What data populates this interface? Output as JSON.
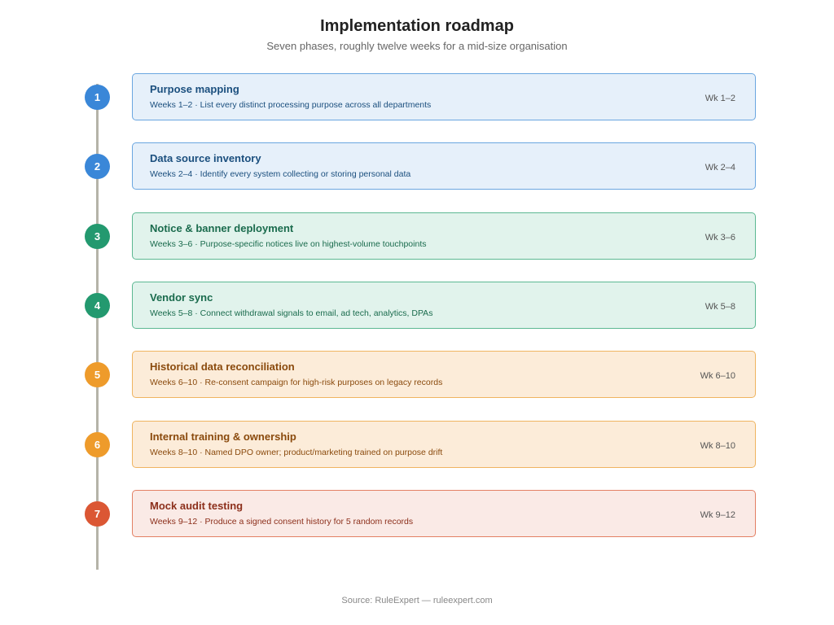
{
  "header": {
    "title": "Implementation roadmap",
    "subtitle": "Seven phases, roughly twelve weeks for a mid-size organisation"
  },
  "themes": {
    "blue": {
      "node": "#3a87d8",
      "bg": "#e6f0fa",
      "border": "#6aa6e0",
      "text": "#1b4f7e"
    },
    "green": {
      "node": "#23996f",
      "bg": "#e1f3ec",
      "border": "#5cb892",
      "text": "#1a6b4d"
    },
    "amber": {
      "node": "#ee9b2b",
      "bg": "#fcecd9",
      "border": "#efb460",
      "text": "#8a4a0d"
    },
    "red": {
      "node": "#db5734",
      "bg": "#faeae6",
      "border": "#e38064",
      "text": "#8c2f1b"
    }
  },
  "phases": [
    {
      "number": "1",
      "title": "Purpose mapping",
      "description": "Weeks 1–2 · List every distinct processing purpose across all departments",
      "weeks": "Wk 1–2",
      "theme": "blue"
    },
    {
      "number": "2",
      "title": "Data source inventory",
      "description": "Weeks 2–4 · Identify every system collecting or storing personal data",
      "weeks": "Wk 2–4",
      "theme": "blue"
    },
    {
      "number": "3",
      "title": "Notice & banner deployment",
      "description": "Weeks 3–6 · Purpose-specific notices live on highest-volume touchpoints",
      "weeks": "Wk 3–6",
      "theme": "green"
    },
    {
      "number": "4",
      "title": "Vendor sync",
      "description": "Weeks 5–8 · Connect withdrawal signals to email, ad tech, analytics, DPAs",
      "weeks": "Wk 5–8",
      "theme": "green"
    },
    {
      "number": "5",
      "title": "Historical data reconciliation",
      "description": "Weeks 6–10 · Re-consent campaign for high-risk purposes on legacy records",
      "weeks": "Wk 6–10",
      "theme": "amber"
    },
    {
      "number": "6",
      "title": "Internal training & ownership",
      "description": "Weeks 8–10 · Named DPO owner; product/marketing trained on purpose drift",
      "weeks": "Wk 8–10",
      "theme": "amber"
    },
    {
      "number": "7",
      "title": "Mock audit testing",
      "description": "Weeks 9–12 · Produce a signed consent history for 5 random records",
      "weeks": "Wk 9–12",
      "theme": "red"
    }
  ],
  "footer": {
    "source": "Source: RuleExpert — ruleexpert.com"
  }
}
